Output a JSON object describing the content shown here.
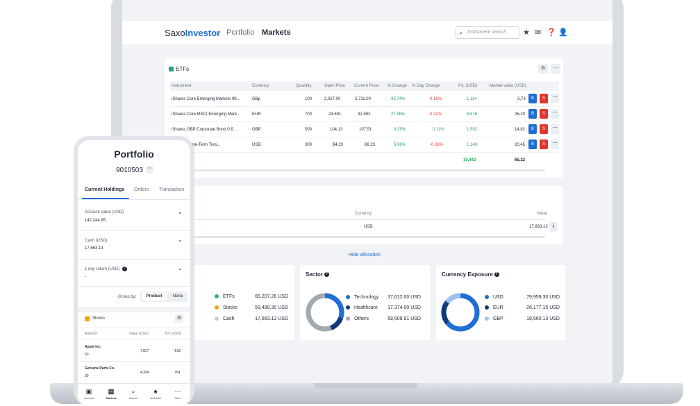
{
  "app": {
    "logo_prefix": "Saxo",
    "logo_suffix": "Investor",
    "nav": {
      "portfolio": "Portfolio",
      "markets": "Markets"
    },
    "search_placeholder": "Instrument search",
    "icons": [
      "search-icon",
      "star-icon",
      "mail-icon",
      "help-icon",
      "user-icon"
    ]
  },
  "etf": {
    "title": "ETFs",
    "columns": [
      "Instrument",
      "Currency",
      "Quantity",
      "Open Price",
      "Current Price",
      "% Change",
      "% Day Change",
      "P/L (USD)",
      "Market value (USD)"
    ],
    "rows": [
      {
        "instrument": "iShares Core Emerging Markets IM...",
        "currency": "GBp",
        "quantity": "100",
        "open": "2,027.00",
        "current": "2,711.00",
        "change": "33.74%",
        "day_change": "-0.19%",
        "pl": "1,114",
        "value": "3,73",
        "buy": "B",
        "sell": "S"
      },
      {
        "instrument": "iShares Core MSCI Emerging Mark...",
        "currency": "EUR",
        "quantity": "700",
        "open": "24.691",
        "current": "31.592",
        "change": "27.95%",
        "day_change": "-0.22%",
        "pl": "6,576",
        "value": "26,20",
        "buy": "B",
        "sell": "S"
      },
      {
        "instrument": "iShares GBP Corporate Bond 0-5...",
        "currency": "GBP",
        "quantity": "500",
        "open": "104.13",
        "current": "107.51",
        "change": "3.25%",
        "day_change": "0.11%",
        "pl": "1,592",
        "value": "14,82",
        "buy": "B",
        "sell": "S"
      },
      {
        "instrument": "...ntermediate-Term Tres...",
        "currency": "USD",
        "quantity": "300",
        "open": "$4.23",
        "current": "66.23",
        "change": "5.96%",
        "day_change": "-0.06%",
        "pl": "1,140",
        "value": "20,45",
        "buy": "B",
        "sell": "S"
      }
    ],
    "total_pl": "10,442",
    "total_value": "65,22"
  },
  "cash": {
    "col_currency": "Currency",
    "col_value": "Value",
    "currency": "USD",
    "value": "17,663.13"
  },
  "hide_allocation": "Hide allocation",
  "asset_class": {
    "legend": [
      {
        "label": "ETFs",
        "value": "65,207.26 USD",
        "color": "#1fb87a"
      },
      {
        "label": "Stocks",
        "value": "59,490.30 USD",
        "color": "#f0a500"
      },
      {
        "label": "Cash",
        "value": "17,663.13 USD",
        "color": "#c6cbd2"
      }
    ]
  },
  "sector": {
    "title": "Sector",
    "legend": [
      {
        "label": "Technology",
        "value": "37,612.00 USD",
        "color": "#1f6ed4"
      },
      {
        "label": "Healthcare",
        "value": "17,374.00 USD",
        "color": "#123a7a"
      },
      {
        "label": "Others",
        "value": "69,509.91 USD",
        "color": "#a3a9b2"
      }
    ]
  },
  "currency_exposure": {
    "title": "Currency Exposure",
    "legend": [
      {
        "label": "USD",
        "value": "79,959.30 USD",
        "color": "#1f6ed4"
      },
      {
        "label": "EUR",
        "value": "26,177.15 USD",
        "color": "#123a7a"
      },
      {
        "label": "GBP",
        "value": "18,560.13 USD",
        "color": "#9cc2f0"
      }
    ]
  },
  "phone": {
    "title": "Portfolio",
    "account": "9010503",
    "tabs": [
      "Current Holdings",
      "Orders",
      "Transaction"
    ],
    "account_value_label": "Account value (USD)",
    "account_value": "142,244.95",
    "cash_label": "Cash (USD)",
    "cash_value": "17,663.13",
    "day_return_label": "1 day return (USD)",
    "day_return_value": "-",
    "group_by": "Group by:",
    "group_product": "Product",
    "group_none": "None",
    "stocks_title": "Stocks",
    "stocks_cols": [
      "Amount",
      "Value (USD)",
      "P/L (USD)"
    ],
    "stocks": [
      {
        "name": "Apple Inc.",
        "amount": "50",
        "value": "7,827",
        "pl": "-518"
      },
      {
        "name": "Genuine Parts Co.",
        "amount": "30",
        "value": "4,304",
        "pl": "754"
      }
    ],
    "bottom_nav": [
      "Account",
      "Markets",
      "Search",
      "Watchlist",
      "More"
    ]
  }
}
